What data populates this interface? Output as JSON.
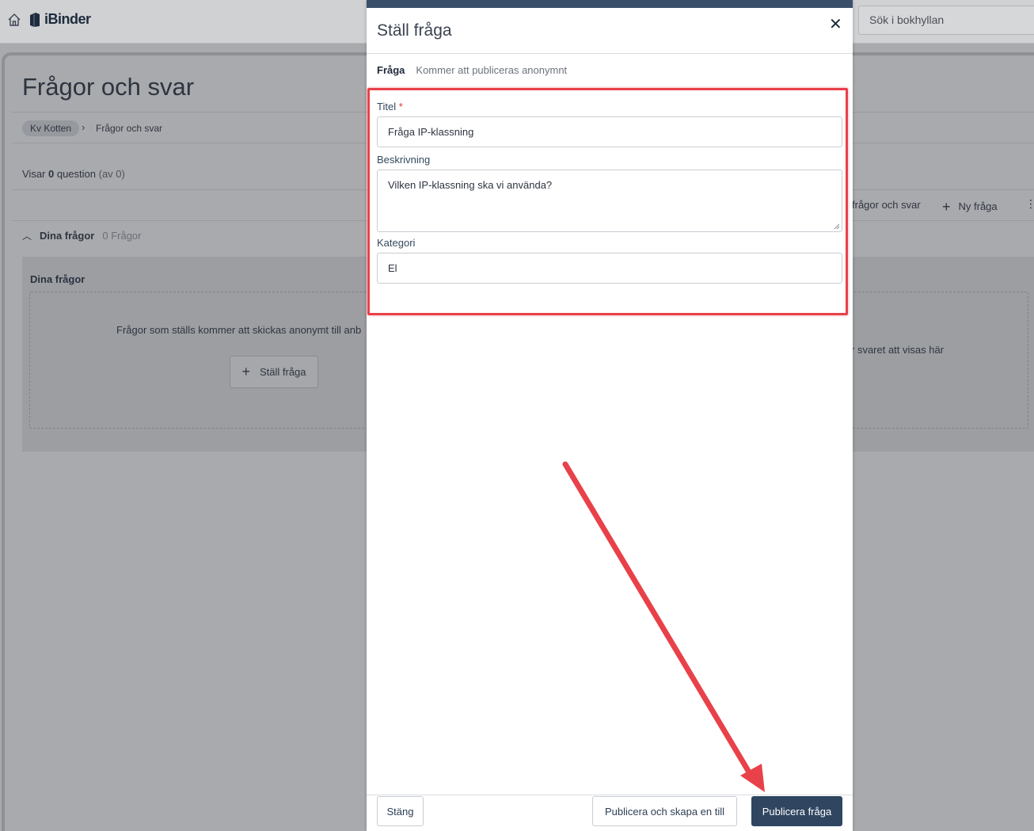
{
  "app": {
    "logo_text": "iBinder",
    "search_placeholder": "Sök i bokhyllan"
  },
  "page": {
    "title": "Frågor och svar",
    "breadcrumb": {
      "root": "Kv Kotten",
      "current": "Frågor och svar"
    },
    "showing": {
      "prefix": "Visar ",
      "count": "0",
      "noun": " question ",
      "total": "(av 0)"
    },
    "toolbar": {
      "qa_link": "frågor och svar",
      "new_question": "Ny fråga"
    },
    "section": {
      "title": "Dina frågor",
      "count": "0 Frågor"
    },
    "panel": {
      "title": "Dina frågor",
      "empty_text": "Frågor som ställs kommer att skickas anonymt till anb",
      "empty_text_right": "r svaret att visas här",
      "ask_button": "Ställ fråga"
    }
  },
  "modal": {
    "title": "Ställ fråga",
    "tab_label": "Fråga",
    "tab_hint": "Kommer att publiceras anonymnt",
    "fields": {
      "title_label": "Titel",
      "title_required": "*",
      "title_value": "Fråga IP-klassning",
      "description_label": "Beskrivning",
      "description_value": "Vilken IP-klassning ska vi använda?",
      "category_label": "Kategori",
      "category_value": "El"
    },
    "footer": {
      "close": "Stäng",
      "publish_and_new": "Publicera och skapa en till",
      "publish": "Publicera fråga"
    }
  },
  "annotation": {
    "color": "#e8414a"
  }
}
